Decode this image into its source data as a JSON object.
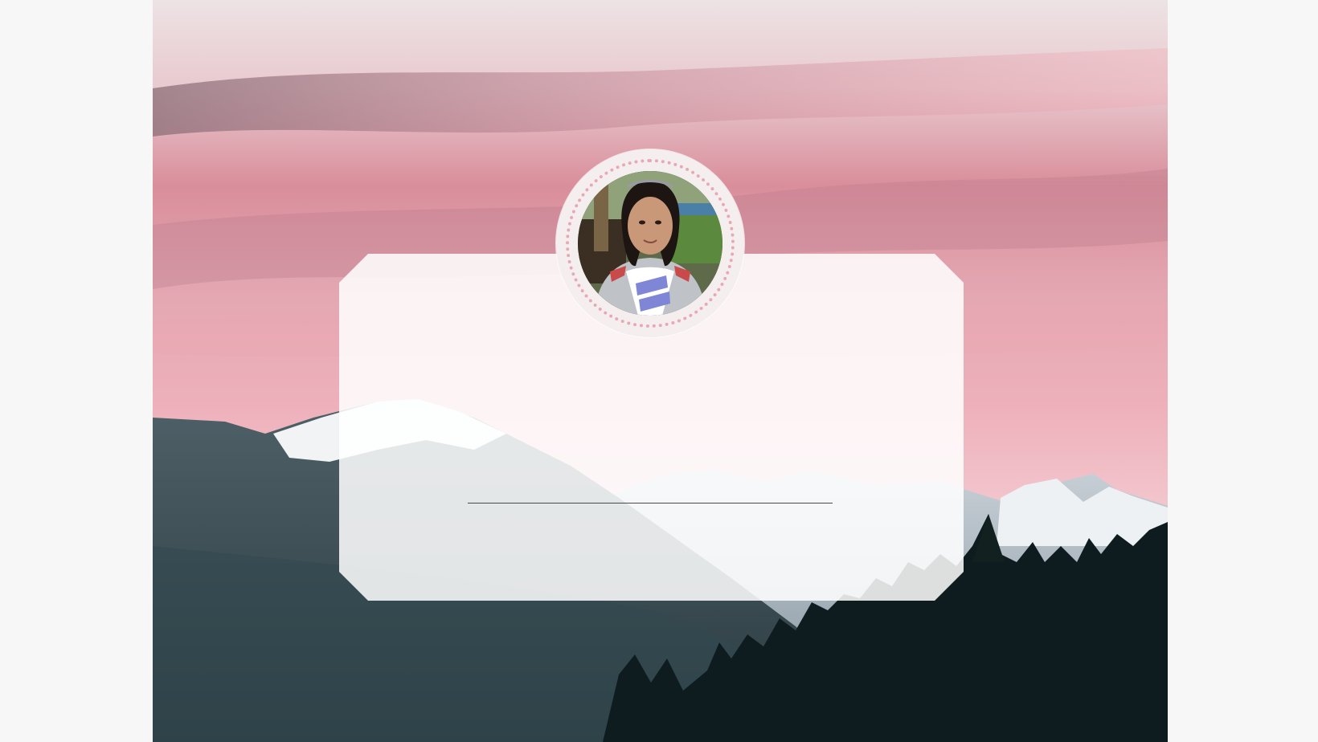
{
  "colors": {
    "page_background": "#f7f7f7",
    "sky_top": "#efe6e6",
    "sky_pink": "#f29aa6",
    "mountain_dark": "#2b3d42",
    "forest": "#0f1c1f",
    "snow": "#f3f4f6",
    "card": "#ffffff",
    "avatar_ring": "#f4eeee",
    "avatar_dots": "#e9a8b5"
  },
  "profile": {
    "photo": "profile-photo"
  }
}
